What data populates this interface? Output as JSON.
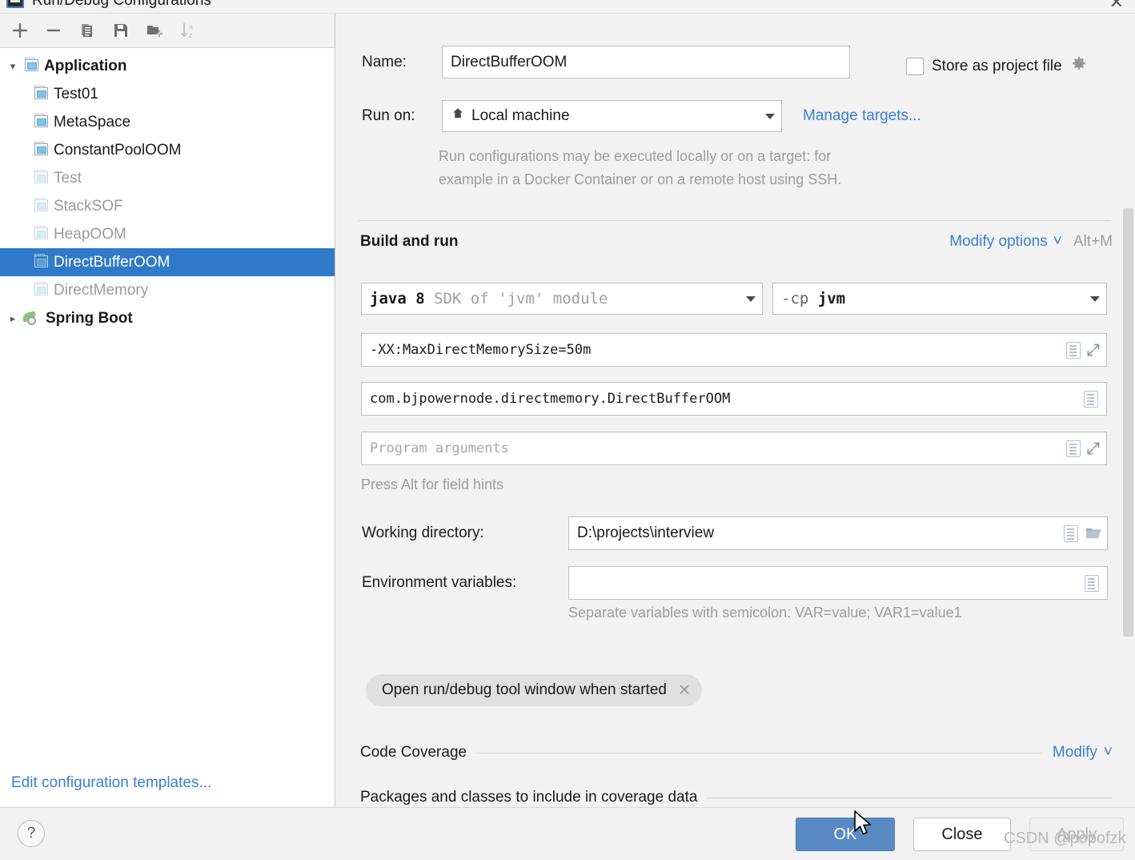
{
  "window": {
    "title": "Run/Debug Configurations",
    "close_label": "✕",
    "app_icon": "run-debug-icon"
  },
  "sidebar": {
    "toolbar": [
      {
        "name": "add-configuration-button",
        "icon": "plus-icon",
        "enabled": true
      },
      {
        "name": "remove-configuration-button",
        "icon": "minus-icon",
        "enabled": true
      },
      {
        "name": "copy-configuration-button",
        "icon": "copy-icon",
        "enabled": true
      },
      {
        "name": "save-configuration-button",
        "icon": "save-icon",
        "enabled": true
      },
      {
        "name": "new-folder-button",
        "icon": "folder-plus-icon",
        "enabled": true
      },
      {
        "name": "sort-configurations-button",
        "icon": "sort-az-icon",
        "enabled": false
      }
    ],
    "tree": [
      {
        "label": "Application",
        "type": "group",
        "expanded": true,
        "dim": false,
        "selected": false
      },
      {
        "label": "Test01",
        "type": "config",
        "dim": false,
        "selected": false
      },
      {
        "label": "MetaSpace",
        "type": "config",
        "dim": false,
        "selected": false
      },
      {
        "label": "ConstantPoolOOM",
        "type": "config",
        "dim": false,
        "selected": false
      },
      {
        "label": "Test",
        "type": "config",
        "dim": true,
        "selected": false
      },
      {
        "label": "StackSOF",
        "type": "config",
        "dim": true,
        "selected": false
      },
      {
        "label": "HeapOOM",
        "type": "config",
        "dim": true,
        "selected": false
      },
      {
        "label": "DirectBufferOOM",
        "type": "config",
        "dim": false,
        "selected": true
      },
      {
        "label": "DirectMemory",
        "type": "config",
        "dim": true,
        "selected": false
      },
      {
        "label": "Spring Boot",
        "type": "group",
        "expanded": false,
        "dim": false,
        "selected": false
      }
    ],
    "edit_templates_link": "Edit configuration templates..."
  },
  "form": {
    "name_label": "Name:",
    "name_value": "DirectBufferOOM",
    "store_as_project_file_label": "Store as project file",
    "store_as_project_file_checked": false,
    "run_on_label": "Run on:",
    "run_on_value": "Local machine",
    "manage_targets_link": "Manage targets...",
    "target_hint_line1": "Run configurations may be executed locally or on a target: for",
    "target_hint_line2": "example in a Docker Container or on a remote host using SSH.",
    "build_and_run_title": "Build and run",
    "modify_options_link": "Modify options",
    "modify_options_shortcut": "Alt+M",
    "jre_value_strong": "java 8",
    "jre_value_rest": " SDK of 'jvm' module",
    "classpath_value_prefix": "-cp ",
    "classpath_value_module": "jvm",
    "vm_options_value": "-XX:MaxDirectMemorySize=50m",
    "main_class_value": "com.bjpowernode.directmemory.DirectBufferOOM",
    "program_arguments_placeholder": "Program arguments",
    "program_arguments_value": "",
    "field_hints_text": "Press Alt for field hints",
    "working_directory_label": "Working directory:",
    "working_directory_value": "D:\\projects\\interview",
    "environment_variables_label": "Environment variables:",
    "environment_variables_value": "",
    "environment_variables_hint": "Separate variables with semicolon: VAR=value; VAR1=value1",
    "open_tool_window_chip": "Open run/debug tool window when started",
    "chip_remove_label": "✕",
    "code_coverage_title": "Code Coverage",
    "code_coverage_modify_link": "Modify",
    "coverage_packages_title": "Packages and classes to include in coverage data"
  },
  "footer": {
    "help_label": "?",
    "ok_label": "OK",
    "close_label": "Close",
    "apply_label": "Apply",
    "apply_enabled": false,
    "watermark": "CSDN @popofzk"
  },
  "colors": {
    "selection_blue": "#2f7ac9",
    "link_blue": "#3b7dd8",
    "ok_button_blue": "#5a8ac4",
    "panel_gray": "#f2f2f2",
    "spring_green": "#8cc474"
  }
}
